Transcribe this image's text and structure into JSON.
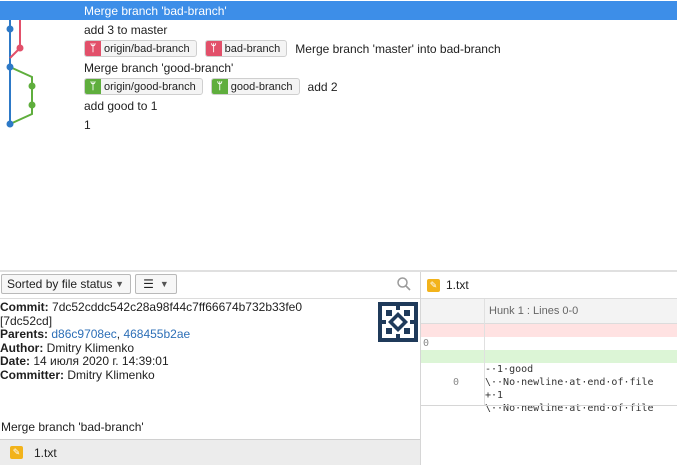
{
  "graph": {
    "rows": [
      {
        "message": "Merge branch 'bad-branch'",
        "refs": [],
        "selected": true
      },
      {
        "message": "add 3 to master",
        "refs": []
      },
      {
        "message": "Merge branch 'master' into bad-branch",
        "refs": [
          {
            "label": "origin/bad-branch",
            "color": "red"
          },
          {
            "label": "bad-branch",
            "color": "red"
          }
        ]
      },
      {
        "message": "Merge branch 'good-branch'",
        "refs": []
      },
      {
        "message": "add 2",
        "refs": [
          {
            "label": "origin/good-branch",
            "color": "green"
          },
          {
            "label": "good-branch",
            "color": "green"
          }
        ]
      },
      {
        "message": "add good to 1",
        "refs": []
      },
      {
        "message": "1",
        "refs": []
      }
    ],
    "colors": {
      "blue": "#2d79c7",
      "red": "#e2506a",
      "green": "#5fae3d"
    }
  },
  "toolbar": {
    "sort_label": "Sorted by file status",
    "search_icon": "search-icon"
  },
  "details": {
    "commit_label": "Commit:",
    "commit_hash": "7dc52cddc542c28a98f44c7ff66674b732b33fe0",
    "commit_short": "[7dc52cd]",
    "parents_label": "Parents:",
    "parent_1": "d86c9708ec",
    "parent_2": "468455b2ae",
    "author_label": "Author:",
    "author": "Dmitry Klimenko",
    "date_label": "Date:",
    "date": "14 июля 2020 г. 14:39:01",
    "committer_label": "Committer:",
    "committer": "Dmitry Klimenko",
    "message": "Merge branch 'bad-branch'"
  },
  "changed_file": {
    "name": "1.txt"
  },
  "diff": {
    "file_name": "1.txt",
    "hunk_label": "Hunk 1 : Lines 0-0",
    "lines": [
      {
        "type": "del",
        "old": "0",
        "new": "",
        "text": "-·1·good"
      },
      {
        "type": "ctx",
        "old": "",
        "new": "",
        "text": "\\··No·newline·at·end·of·file"
      },
      {
        "type": "add",
        "old": "",
        "new": "0",
        "text": "+·1"
      },
      {
        "type": "ctx",
        "old": "",
        "new": "",
        "text": "\\··No·newline·at·end·of·file"
      }
    ]
  }
}
